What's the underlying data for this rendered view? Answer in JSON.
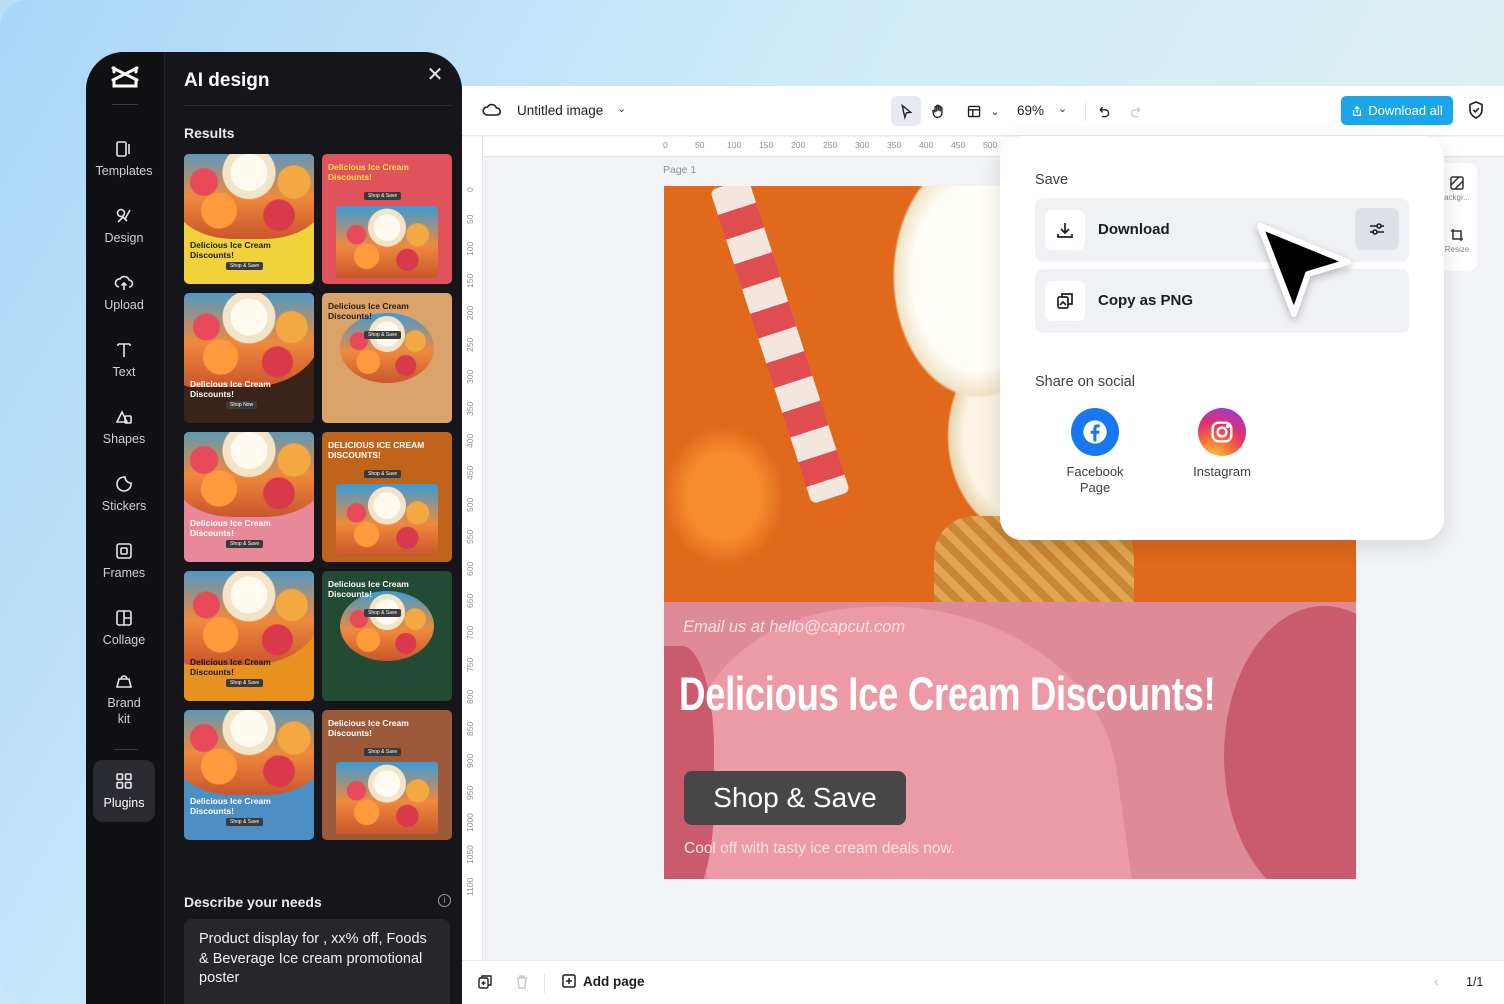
{
  "sidebar": {
    "items": [
      {
        "label": "Templates",
        "icon": "templates-icon"
      },
      {
        "label": "Design",
        "icon": "design-icon"
      },
      {
        "label": "Upload",
        "icon": "upload-icon"
      },
      {
        "label": "Text",
        "icon": "text-icon"
      },
      {
        "label": "Shapes",
        "icon": "shapes-icon"
      },
      {
        "label": "Stickers",
        "icon": "stickers-icon"
      },
      {
        "label": "Frames",
        "icon": "frames-icon"
      },
      {
        "label": "Collage",
        "icon": "collage-icon"
      },
      {
        "label": "Brand kit",
        "icon": "brand-kit-icon"
      },
      {
        "label": "Plugins",
        "icon": "plugins-icon",
        "active": true
      }
    ]
  },
  "ai_panel": {
    "title": "AI design",
    "results_label": "Results",
    "thumbnails": [
      {
        "title": "Delicious Ice Cream Discounts!",
        "button": "Shop & Save",
        "bg": "#f0d23a",
        "text_color": "#1a1a1a"
      },
      {
        "title": "Delicious Ice Cream Discounts!",
        "button": "Shop & Save",
        "bg": "#e0535d",
        "text_color": "#ffe04a"
      },
      {
        "title": "Delicious Ice Cream Discounts!",
        "button": "Shop Now",
        "bg": "#3a2419",
        "text_color": "#ffffff"
      },
      {
        "title": "Delicious Ice Cream Discounts!",
        "button": "Shop & Save",
        "bg": "#d9a36a",
        "text_color": "#2a1a10"
      },
      {
        "title": "Delicious Ice Cream Discounts!",
        "button": "Shop & Save",
        "bg": "#e8899a",
        "text_color": "#ffffff"
      },
      {
        "title": "DELICIOUS ICE CREAM DISCOUNTS!",
        "button": "Shop & Save",
        "bg": "#c0641b",
        "text_color": "#ffffff"
      },
      {
        "title": "Delicious Ice Cream Discounts!",
        "button": "Shop & Save",
        "bg": "#e7921f",
        "text_color": "#1a1a1a"
      },
      {
        "title": "Delicious Ice Cream Discounts!",
        "button": "Shop & Save",
        "bg": "#234a35",
        "text_color": "#ffffff"
      },
      {
        "title": "Delicious Ice Cream Discounts!",
        "button": "Shop & Save",
        "bg": "#4b8fc4",
        "text_color": "#ffffff"
      },
      {
        "title": "Delicious Ice Cream Discounts!",
        "button": "Shop & Save",
        "bg": "#9c5a3a",
        "text_color": "#ffffff"
      }
    ],
    "describe_label": "Describe your needs",
    "prompt": "Product display for , xx% off, Foods & Beverage Ice cream promotional poster"
  },
  "topbar": {
    "doc_title": "Untitled image",
    "zoom": "69%",
    "download_all": "Download all"
  },
  "rulers": {
    "horizontal": [
      "0",
      "50",
      "100",
      "150",
      "200",
      "250",
      "300",
      "350",
      "400",
      "450",
      "500"
    ],
    "vertical": [
      "0",
      "50",
      "100",
      "150",
      "200",
      "250",
      "300",
      "350",
      "400",
      "450",
      "500",
      "550",
      "600",
      "650",
      "700",
      "750",
      "800",
      "850",
      "900",
      "950",
      "1000",
      "1050",
      "1100"
    ]
  },
  "canvas": {
    "page_label": "Page 1",
    "email": "Email us at hello@capcut.com",
    "headline": "Delicious Ice Cream Discounts!",
    "cta": "Shop & Save",
    "tagline": "Cool off with tasty ice cream deals now."
  },
  "side_tools": {
    "background": "ackgr...",
    "resize": "Resize"
  },
  "bottombar": {
    "add_page": "Add page",
    "pager": "1/1"
  },
  "popup": {
    "save_label": "Save",
    "download": "Download",
    "copy_png": "Copy as PNG",
    "share_label": "Share on social",
    "facebook": "Facebook Page",
    "instagram": "Instagram"
  }
}
